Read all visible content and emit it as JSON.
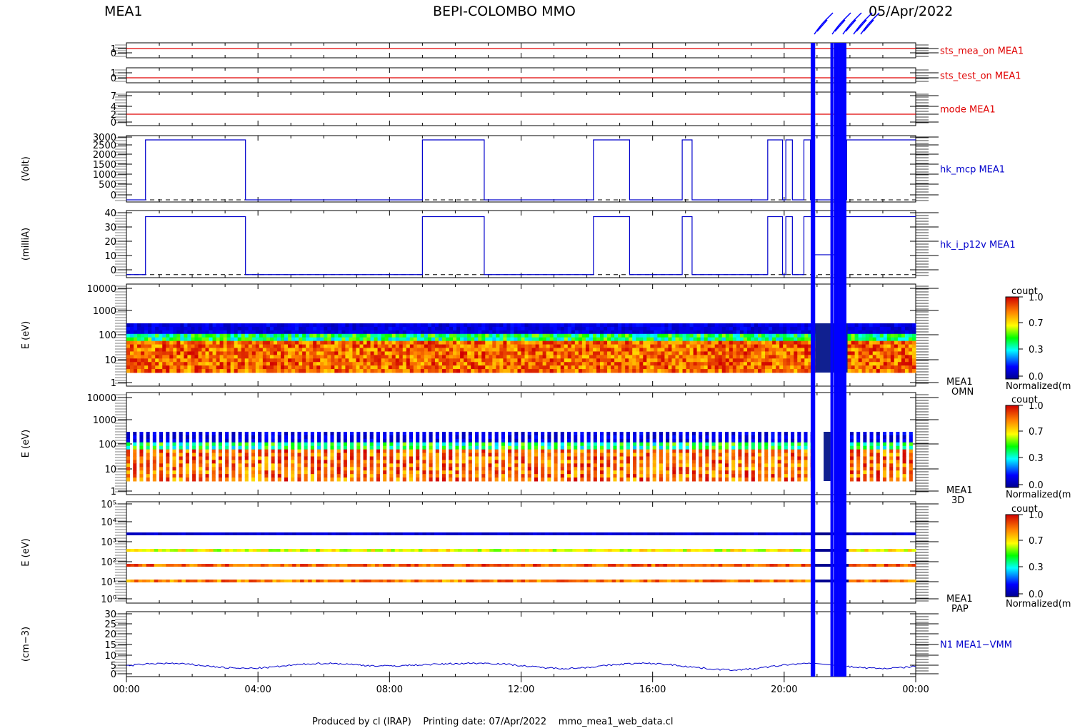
{
  "header": {
    "left": "MEA1",
    "center": "BEPI-COLOMBO MMO",
    "right": "05/Apr/2022"
  },
  "footer": "Produced by cl (IRAP)    Printing date: 07/Apr/2022    mmo_mea1_web_data.cl",
  "colors": {
    "status": "#e00000",
    "hk": "#0000cc",
    "spike": "#0000ff",
    "dash": "#000000"
  },
  "chart_data": {
    "type": "line",
    "x_ticks": [
      "00:00",
      "04:00",
      "08:00",
      "12:00",
      "16:00",
      "20:00",
      "00:00"
    ],
    "x_range_hours": [
      0,
      24
    ],
    "spike_hours": [
      20.85,
      20.9,
      21.45,
      21.55,
      21.62,
      21.7,
      21.78,
      21.85
    ],
    "panels": [
      {
        "id": "sts_mea_on",
        "ylabel": "",
        "legend": "sts_mea_on MEA1",
        "legend_color": "#e00000",
        "yticks": [
          "1",
          "0"
        ],
        "ylim": [
          0,
          1
        ],
        "series": [
          {
            "x": [
              0,
              24
            ],
            "y": [
              1,
              1
            ]
          }
        ]
      },
      {
        "id": "sts_test_on",
        "ylabel": "",
        "legend": "sts_test_on MEA1",
        "legend_color": "#e00000",
        "yticks": [
          "1",
          "0"
        ],
        "ylim": [
          0,
          1
        ],
        "series": [
          {
            "x": [
              0,
              24
            ],
            "y": [
              0,
              0
            ]
          }
        ]
      },
      {
        "id": "mode",
        "ylabel": "",
        "legend": "mode MEA1",
        "legend_color": "#e00000",
        "yticks": [
          "7",
          "4",
          "2",
          "0"
        ],
        "ylim": [
          0,
          7
        ],
        "series": [
          {
            "x": [
              0,
              24
            ],
            "y": [
              2,
              2
            ]
          }
        ]
      },
      {
        "id": "hk_mcp",
        "ylabel": "(Volt)",
        "legend": "hk_mcp MEA1",
        "legend_color": "#0000cc",
        "yticks": [
          "3000",
          "2500",
          "2000",
          "1500",
          "1000",
          "500",
          "0"
        ],
        "ylim": [
          -100,
          3000
        ],
        "high": 2800,
        "low": 0,
        "off_intervals": [
          [
            0,
            0.58
          ],
          [
            3.62,
            9.0
          ],
          [
            10.88,
            14.2
          ],
          [
            15.3,
            16.9
          ],
          [
            17.2,
            19.5
          ],
          [
            19.95,
            20.05
          ],
          [
            20.25,
            20.6
          ],
          [
            20.8,
            21.9
          ]
        ]
      },
      {
        "id": "hk_i_p12v",
        "ylabel": "(milliA)",
        "legend": "hk_i_p12v MEA1",
        "legend_color": "#0000cc",
        "yticks": [
          "40",
          "30",
          "20",
          "10",
          "0"
        ],
        "ylim": [
          -2,
          42
        ],
        "high": 38,
        "low": 0,
        "off_intervals": [
          [
            0,
            0.58
          ],
          [
            3.62,
            9.0
          ],
          [
            10.88,
            14.2
          ],
          [
            15.3,
            16.9
          ],
          [
            17.2,
            19.5
          ],
          [
            19.95,
            20.05
          ],
          [
            20.25,
            20.6
          ]
        ],
        "mid_interval": [
          20.9,
          21.6
        ],
        "mid_value": 13
      },
      {
        "id": "omn",
        "ylabel": "E (eV)",
        "legend": "MEA1",
        "legend2": "OMN",
        "legend_color": "#000000",
        "yticks": [
          "10000",
          "1000",
          "100",
          "10",
          "1"
        ],
        "spectro": "continuous",
        "colorbar": {
          "title": "count",
          "labels": [
            "1.0",
            "0.7",
            "0.3",
            "0.0"
          ],
          "caption": "Normalized(m"
        }
      },
      {
        "id": "3d",
        "ylabel": "E (eV)",
        "legend": "MEA1",
        "legend2": "3D",
        "legend_color": "#000000",
        "yticks": [
          "10000",
          "1000",
          "100",
          "10",
          "1"
        ],
        "spectro": "striped",
        "colorbar": {
          "title": "count",
          "labels": [
            "1.0",
            "0.7",
            "0.3",
            "0.0"
          ],
          "caption": "Normalized(m"
        }
      },
      {
        "id": "pap",
        "ylabel": "E (eV)",
        "legend": "MEA1",
        "legend2": "PAP",
        "legend_color": "#000000",
        "yticks": [
          "10⁵",
          "10⁴",
          "10³",
          "10²",
          "10¹",
          "10⁰"
        ],
        "spectro": "bands",
        "colorbar": {
          "title": "count",
          "labels": [
            "1.0",
            "0.7",
            "0.3",
            "0.0"
          ],
          "caption": "Normalized(m"
        }
      },
      {
        "id": "n1",
        "ylabel": "(cm−3)",
        "legend": "N1 MEA1−VMM",
        "legend_color": "#0000cc",
        "yticks": [
          "30",
          "25",
          "20",
          "15",
          "10",
          "5",
          "0"
        ],
        "ylim": [
          0,
          30
        ]
      }
    ]
  }
}
